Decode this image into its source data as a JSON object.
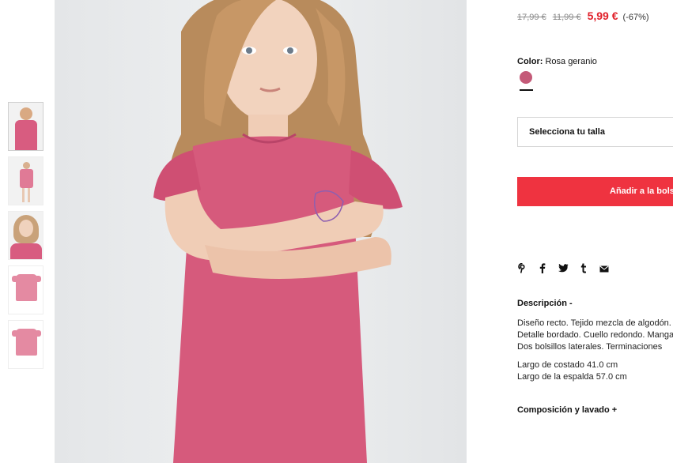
{
  "gallery": {
    "thumbnails": [
      "thumb-front-model",
      "thumb-full-body",
      "thumb-portrait",
      "thumb-dress-front",
      "thumb-dress-back"
    ]
  },
  "price": {
    "original_1": "17,99 €",
    "original_2": "11,99 €",
    "sale": "5,99 €",
    "discount": "(-67%)"
  },
  "color": {
    "label": "Color:",
    "value": "Rosa geranio",
    "swatch_hex": "#c45a78"
  },
  "size": {
    "placeholder": "Selecciona tu talla"
  },
  "cart": {
    "button_label": "Añadir a la bolsa"
  },
  "share_icons": [
    "pinterest-icon",
    "facebook-icon",
    "twitter-icon",
    "tumblr-icon",
    "mail-icon"
  ],
  "description": {
    "title": "Descripción -",
    "lines": [
      "Diseño recto. Tejido mezcla de algodón.",
      "Detalle bordado. Cuello redondo. Mangas",
      "Dos bolsillos laterales. Terminaciones"
    ],
    "measure_1": "Largo de costado 41.0 cm",
    "measure_2": "Largo de la espalda 57.0 cm"
  },
  "composition": {
    "title": "Composición y lavado +"
  }
}
